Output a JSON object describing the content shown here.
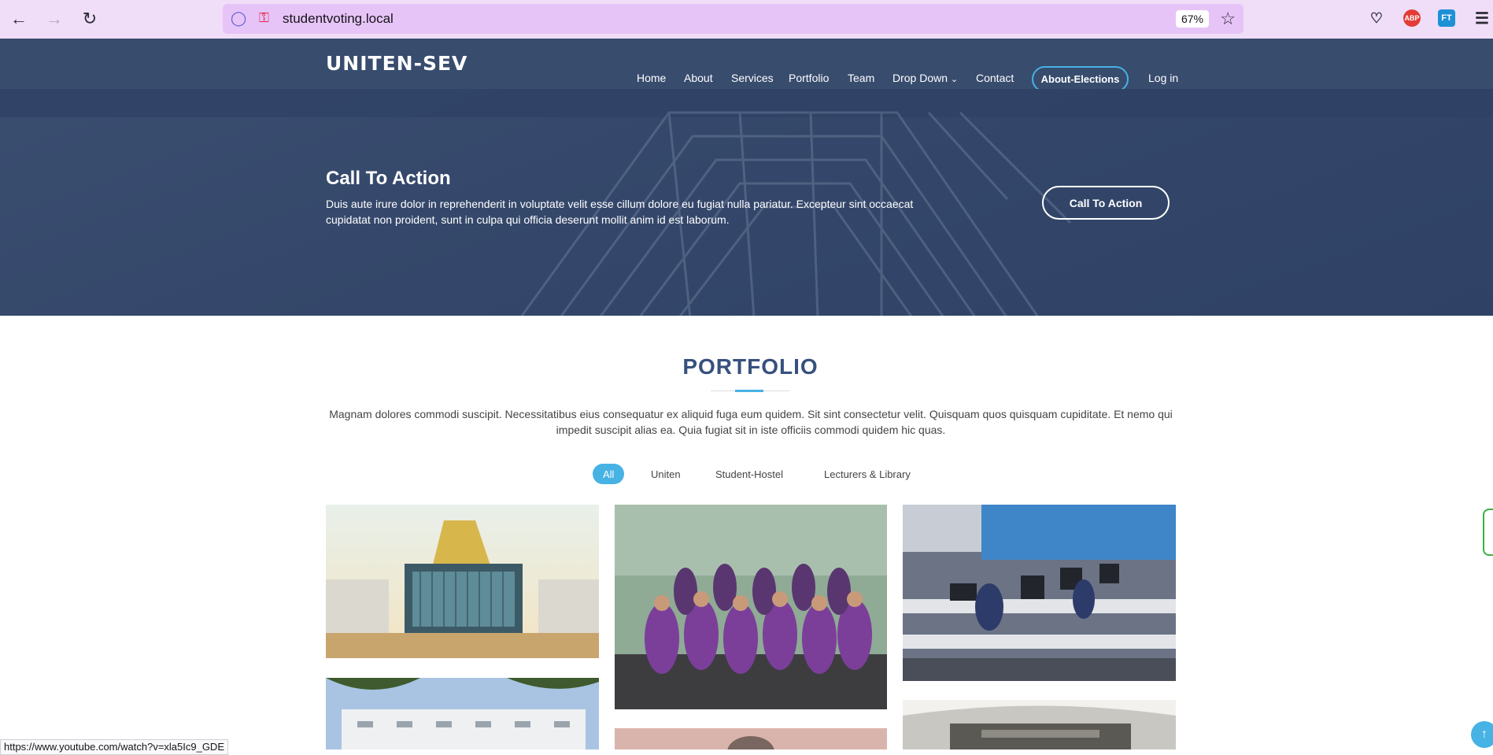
{
  "browser": {
    "url": "studentvoting.local",
    "zoom": "67%",
    "back_icon": "arrow-left-icon",
    "forward_icon": "arrow-right-icon",
    "reload_icon": "reload-icon",
    "extensions": [
      "pocket-icon",
      "adblock-icon",
      "translate-icon",
      "menu-icon"
    ],
    "abp_label": "ABP",
    "ft_label": "FT"
  },
  "header": {
    "logo": "UNITEN-SEV",
    "nav": [
      "Home",
      "About",
      "Services",
      "Portfolio",
      "Team",
      "Drop Down",
      "Contact"
    ],
    "pill": "About-Elections",
    "login": "Log in"
  },
  "hero": {
    "title": "Call To Action",
    "text": "Duis aute irure dolor in reprehenderit in voluptate velit esse cillum dolore eu fugiat nulla pariatur. Excepteur sint occaecat cupidatat non proident, sunt in culpa qui officia deserunt mollit anim id est laborum.",
    "button": "Call To Action"
  },
  "portfolio": {
    "title": "PORTFOLIO",
    "description": "Magnam dolores commodi suscipit. Necessitatibus eius consequatur ex aliquid fuga eum quidem. Sit sint consectetur velit. Quisquam quos quisquam cupiditate. Et nemo qui impedit suscipit alias ea. Quia fugiat sit in iste officiis commodi quidem hic quas.",
    "filters": [
      "All",
      "Uniten",
      "Student-Hostel",
      "Lecturers & Library"
    ],
    "active_filter": "All",
    "items": [
      "campus-building",
      "group-photo",
      "computer-lab",
      "hostel-building",
      "portrait",
      "library-interior"
    ]
  },
  "status_bar": {
    "url": "https://www.youtube.com/watch?v=xla5Ic9_GDE"
  },
  "colors": {
    "accent": "#47b2e4",
    "header_bg": "#384c6e",
    "title": "#37517e"
  }
}
